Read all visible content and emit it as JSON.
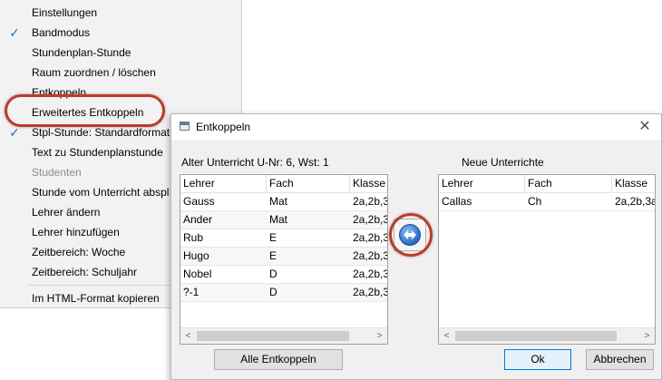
{
  "context_menu": {
    "items": [
      {
        "label": "Einstellungen",
        "checked": false,
        "disabled": false
      },
      {
        "label": "Bandmodus",
        "checked": true,
        "disabled": false
      },
      {
        "label": "Stundenplan-Stunde",
        "checked": false,
        "disabled": false
      },
      {
        "label": "Raum zuordnen / löschen",
        "checked": false,
        "disabled": false
      },
      {
        "label": "Entkoppeln",
        "checked": false,
        "disabled": false
      },
      {
        "label": "Erweitertes Entkoppeln",
        "checked": false,
        "disabled": false
      },
      {
        "label": "Stpl-Stunde: Standardformat",
        "checked": true,
        "disabled": false
      },
      {
        "label": "Text zu Stundenplanstunde",
        "checked": false,
        "disabled": false
      },
      {
        "label": "Studenten",
        "checked": false,
        "disabled": true
      },
      {
        "label": "Stunde vom Unterricht abspl",
        "checked": false,
        "disabled": false
      },
      {
        "label": "Lehrer ändern",
        "checked": false,
        "disabled": false
      },
      {
        "label": "Lehrer hinzufügen",
        "checked": false,
        "disabled": false
      },
      {
        "label": "Zeitbereich: Woche",
        "checked": false,
        "disabled": false
      },
      {
        "label": "Zeitbereich: Schuljahr",
        "checked": false,
        "disabled": false
      },
      {
        "label": "Im HTML-Format kopieren",
        "checked": false,
        "disabled": false
      }
    ],
    "check_glyph": "✓"
  },
  "dialog": {
    "title": "Entkoppeln",
    "close_glyph": "✕",
    "left_label": "Alter Unterricht   U-Nr: 6, Wst: 1",
    "right_label": "Neue Unterrichte",
    "left_table": {
      "columns": [
        "Lehrer",
        "Fach",
        "Klasse"
      ],
      "rows": [
        [
          "Gauss",
          "Mat",
          "2a,2b,3"
        ],
        [
          "Ander",
          "Mat",
          "2a,2b,3"
        ],
        [
          "Rub",
          "E",
          "2a,2b,3"
        ],
        [
          "Hugo",
          "E",
          "2a,2b,3"
        ],
        [
          "Nobel",
          "D",
          "2a,2b,3"
        ],
        [
          "?-1",
          "D",
          "2a,2b,3"
        ]
      ]
    },
    "right_table": {
      "columns": [
        "Lehrer",
        "Fach",
        "Klasse"
      ],
      "rows": [
        [
          "Callas",
          "Ch",
          "2a,2b,3a"
        ]
      ]
    },
    "scroll_left_glyph": "<",
    "scroll_right_glyph": ">",
    "buttons": {
      "alle": "Alle Entkoppeln",
      "ok": "Ok",
      "abbrechen": "Abbrechen"
    },
    "accent_color": "#2d6fc4",
    "highlight_color": "#c0392b"
  }
}
